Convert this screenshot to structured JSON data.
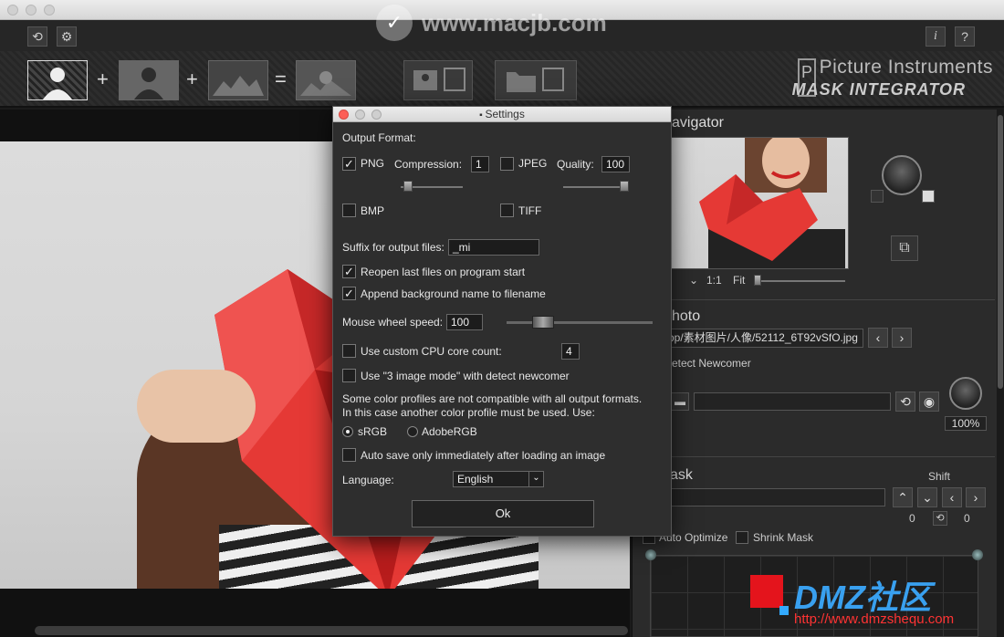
{
  "watermark_top": {
    "text": "www.macjb.com"
  },
  "toolbar": {
    "brand_line1": "Picture Instruments",
    "brand_line2": "MASK INTEGRATOR",
    "operators": [
      "+",
      "+",
      "="
    ],
    "info_label": "i",
    "help_label": "?"
  },
  "navigator": {
    "title": "avigator",
    "zoom_label": "1:1",
    "fit_label": "Fit"
  },
  "photo": {
    "title": "hoto",
    "path": "op/素材图片/人像/52112_6T92vSfO.jpg",
    "detect_label": "etect Newcomer",
    "percent": "100%"
  },
  "mask": {
    "title": "ask",
    "shift_label": "Shift",
    "shift_x": "0",
    "shift_y": "0",
    "auto_optimize_label": "Auto Optimize",
    "shrink_mask_label": "Shrink Mask"
  },
  "dmz": {
    "title": "DMZ社区",
    "url": "http://www.dmzshequ.com"
  },
  "settings": {
    "window_title": "Settings",
    "output_format_label": "Output Format:",
    "png_label": "PNG",
    "compression_label": "Compression:",
    "compression_value": "1",
    "jpeg_label": "JPEG",
    "quality_label": "Quality:",
    "quality_value": "100",
    "bmp_label": "BMP",
    "tiff_label": "TIFF",
    "suffix_label": "Suffix for output files:",
    "suffix_value": "_mi",
    "reopen_label": "Reopen last files on program start",
    "append_label": "Append background name to filename",
    "wheel_label": "Mouse wheel speed:",
    "wheel_value": "100",
    "cpu_label": "Use custom CPU core count:",
    "cpu_value": "4",
    "three_image_label": "Use \"3 image mode\" with detect newcomer",
    "profile_note_1": "Some color profiles are not compatible with all output formats.",
    "profile_note_2": "In this case another color profile must be used. Use:",
    "srgb_label": "sRGB",
    "adobergb_label": "AdobeRGB",
    "autosave_label": "Auto save only immediately after loading an image",
    "language_label": "Language:",
    "language_value": "English",
    "ok_label": "Ok",
    "png_checked": true,
    "reopen_checked": true,
    "append_checked": true
  }
}
